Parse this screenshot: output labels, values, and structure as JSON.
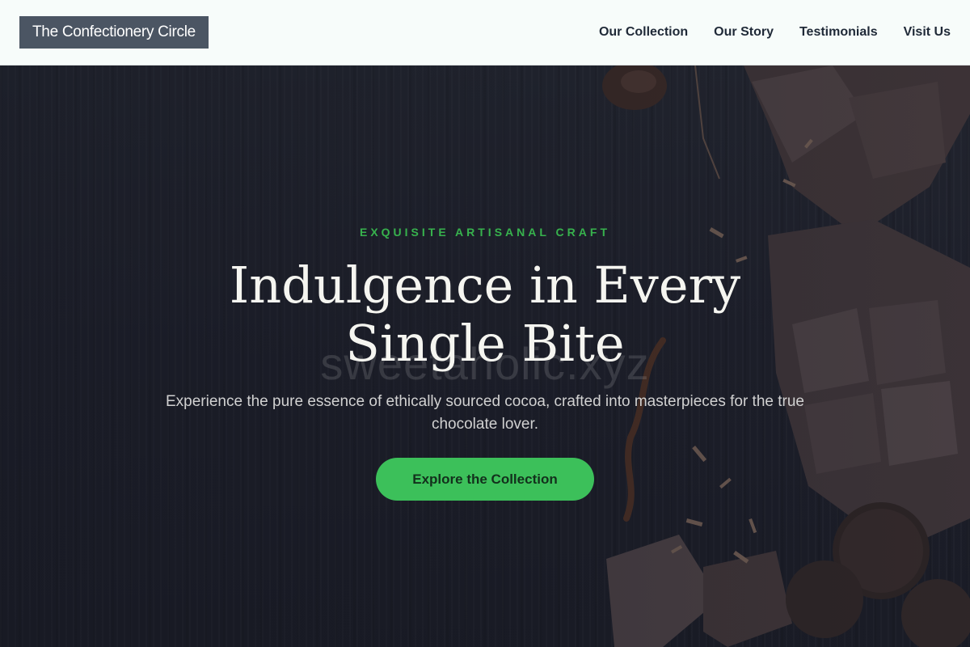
{
  "header": {
    "logo": "The Confectionery Circle",
    "nav": [
      "Our Collection",
      "Our Story",
      "Testimonials",
      "Visit Us"
    ]
  },
  "hero": {
    "eyebrow": "EXQUISITE ARTISANAL CRAFT",
    "headline": "Indulgence in Every Single Bite",
    "watermark": "sweetaholic.xyz",
    "subtitle": "Experience the pure essence of ethically sourced cocoa, crafted into masterpieces for the true chocolate lover.",
    "cta": "Explore the Collection",
    "image": "chocolate-pieces-image"
  },
  "colors": {
    "accent": "#3cc05a",
    "eyebrow": "#37b24d",
    "logo_bg": "#4b5563",
    "header_bg": "#f7fcfa",
    "hero_bg": "#1a1c26"
  }
}
